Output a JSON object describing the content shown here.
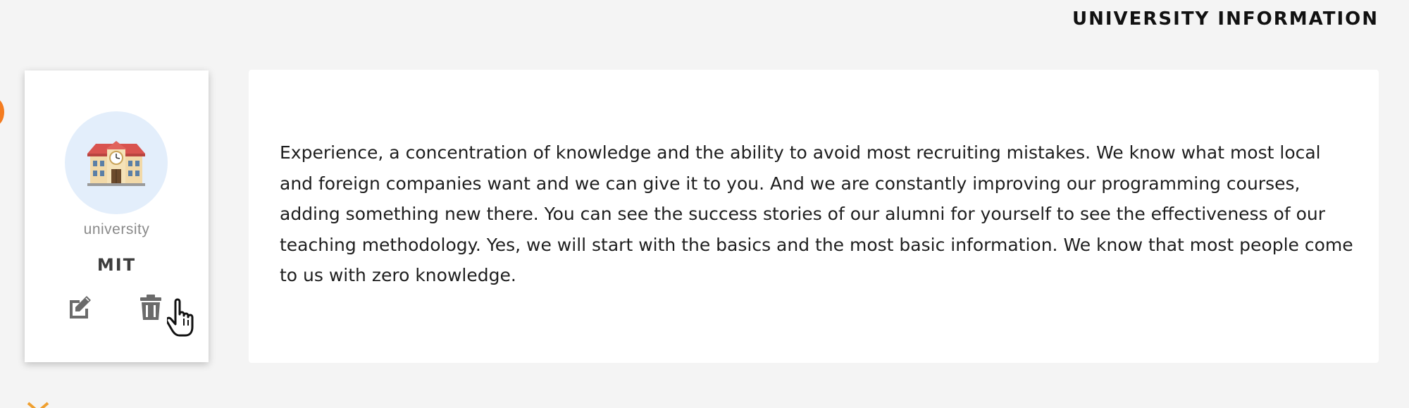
{
  "header": {
    "title": "UNIVERSITY INFORMATION"
  },
  "card": {
    "icon": "school-building-icon",
    "type_label": "university",
    "name": "MIT",
    "actions": {
      "edit_icon": "edit-icon",
      "delete_icon": "trash-icon"
    }
  },
  "details": {
    "description": "Experience, a concentration of knowledge and the ability to avoid most recruiting mistakes. We know what most local and foreign companies want and we can give it to you. And we are constantly improving our programming courses, adding something new there. You can see the success stories of our alumni for yourself to see the effectiveness of our teaching methodology. Yes, we will start with the basics and the most basic information. We know that most people come to us with zero knowledge."
  },
  "colors": {
    "background": "#f4f4f4",
    "card": "#ffffff",
    "avatar_bg": "#e3eefb",
    "accent_orange": "#f47c20",
    "icon_gray": "#6b6b6b"
  }
}
